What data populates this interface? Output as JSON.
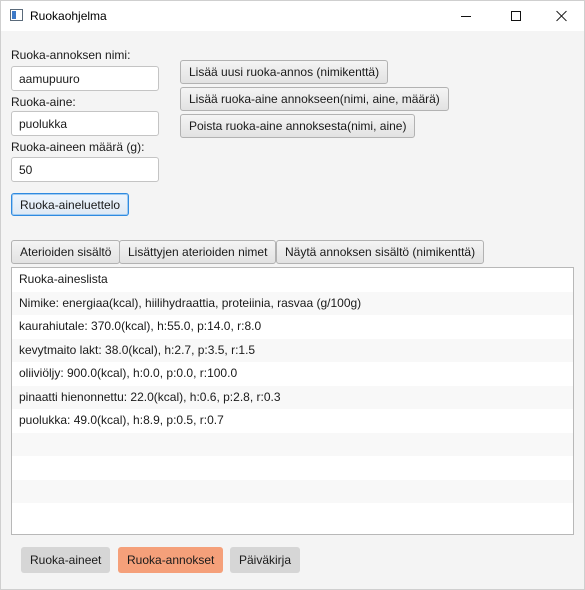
{
  "window": {
    "title": "Ruokaohjelma"
  },
  "form": {
    "name_label": "Ruoka-annoksen nimi:",
    "name_value": "aamupuuro",
    "ingredient_label": "Ruoka-aine:",
    "ingredient_value": "puolukka",
    "amount_label": "Ruoka-aineen määrä (g):",
    "amount_value": "50",
    "ingredient_list_button": "Ruoka-aineluettelo"
  },
  "actions": {
    "add_portion": "Lisää uusi ruoka-annos (nimikenttä)",
    "add_ingredient": "Lisää ruoka-aine annokseen(nimi, aine, määrä)",
    "remove_ingredient": "Poista ruoka-aine annoksesta(nimi, aine)"
  },
  "tabs": [
    {
      "label": "Aterioiden sisältö"
    },
    {
      "label": "Lisättyjen aterioiden nimet"
    },
    {
      "label": "Näytä annoksen sisältö (nimikenttä)"
    }
  ],
  "list": {
    "rows": [
      "Ruoka-aineslista",
      "Nimike: energiaa(kcal), hiilihydraattia, proteiinia, rasvaa (g/100g)",
      "kaurahiutale: 370.0(kcal), h:55.0, p:14.0, r:8.0",
      "kevytmaito lakt: 38.0(kcal), h:2.7, p:3.5, r:1.5",
      "oliiviöljy: 900.0(kcal), h:0.0, p:0.0, r:100.0",
      "pinaatti hienonnettu: 22.0(kcal), h:0.6, p:2.8, r:0.3",
      "puolukka: 49.0(kcal), h:8.9, p:0.5, r:0.7",
      "",
      "",
      "",
      ""
    ]
  },
  "bottom_nav": [
    {
      "label": "Ruoka-aineet",
      "background": "#d6d6d6",
      "active": false
    },
    {
      "label": "Ruoka-annokset",
      "background": "#f5a07a",
      "active": true
    },
    {
      "label": "Päiväkirja",
      "background": "#d6d6d6",
      "active": false
    }
  ]
}
